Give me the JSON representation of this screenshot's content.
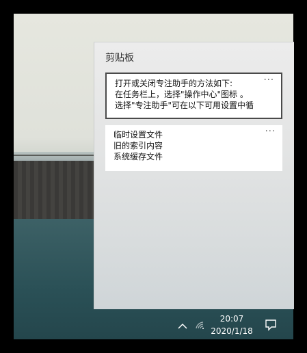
{
  "clipboard": {
    "title": "剪贴板",
    "items": [
      {
        "lines": [
          "打开或关闭专注助手的方法如下:",
          "在任务栏上，选择\"操作中心\"图标 。",
          "选择\"专注助手\"可在以下可用设置中循"
        ],
        "more": "···"
      },
      {
        "lines": [
          "临时设置文件",
          "旧的索引内容",
          "系统缓存文件"
        ],
        "more": "···"
      }
    ]
  },
  "taskbar": {
    "time": "20:07",
    "date": "2020/1/18",
    "icons": [
      "chevron-up-icon",
      "wifi-icon",
      "action-center-icon"
    ]
  }
}
